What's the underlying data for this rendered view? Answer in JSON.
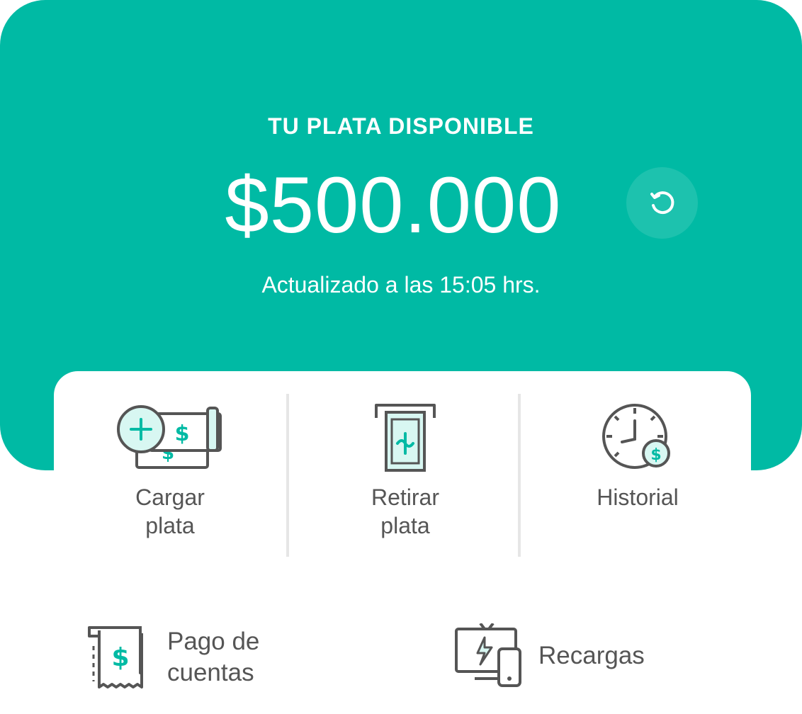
{
  "balance": {
    "title": "TU PLATA DISPONIBLE",
    "amount": "$500.000",
    "updated": "Actualizado a las 15:05 hrs."
  },
  "actions": [
    {
      "label": "Cargar\nplata",
      "icon": "add-money-icon"
    },
    {
      "label": "Retirar\nplata",
      "icon": "atm-withdraw-icon"
    },
    {
      "label": "Historial",
      "icon": "clock-history-icon"
    }
  ],
  "services": [
    {
      "label": "Pago de\ncuentas",
      "icon": "bill-receipt-icon"
    },
    {
      "label": "Recargas",
      "icon": "devices-recharge-icon"
    }
  ],
  "colors": {
    "brand": "#00baa4",
    "accent_light": "#d8f7f2",
    "icon_stroke": "#555555",
    "text": "#555555"
  }
}
